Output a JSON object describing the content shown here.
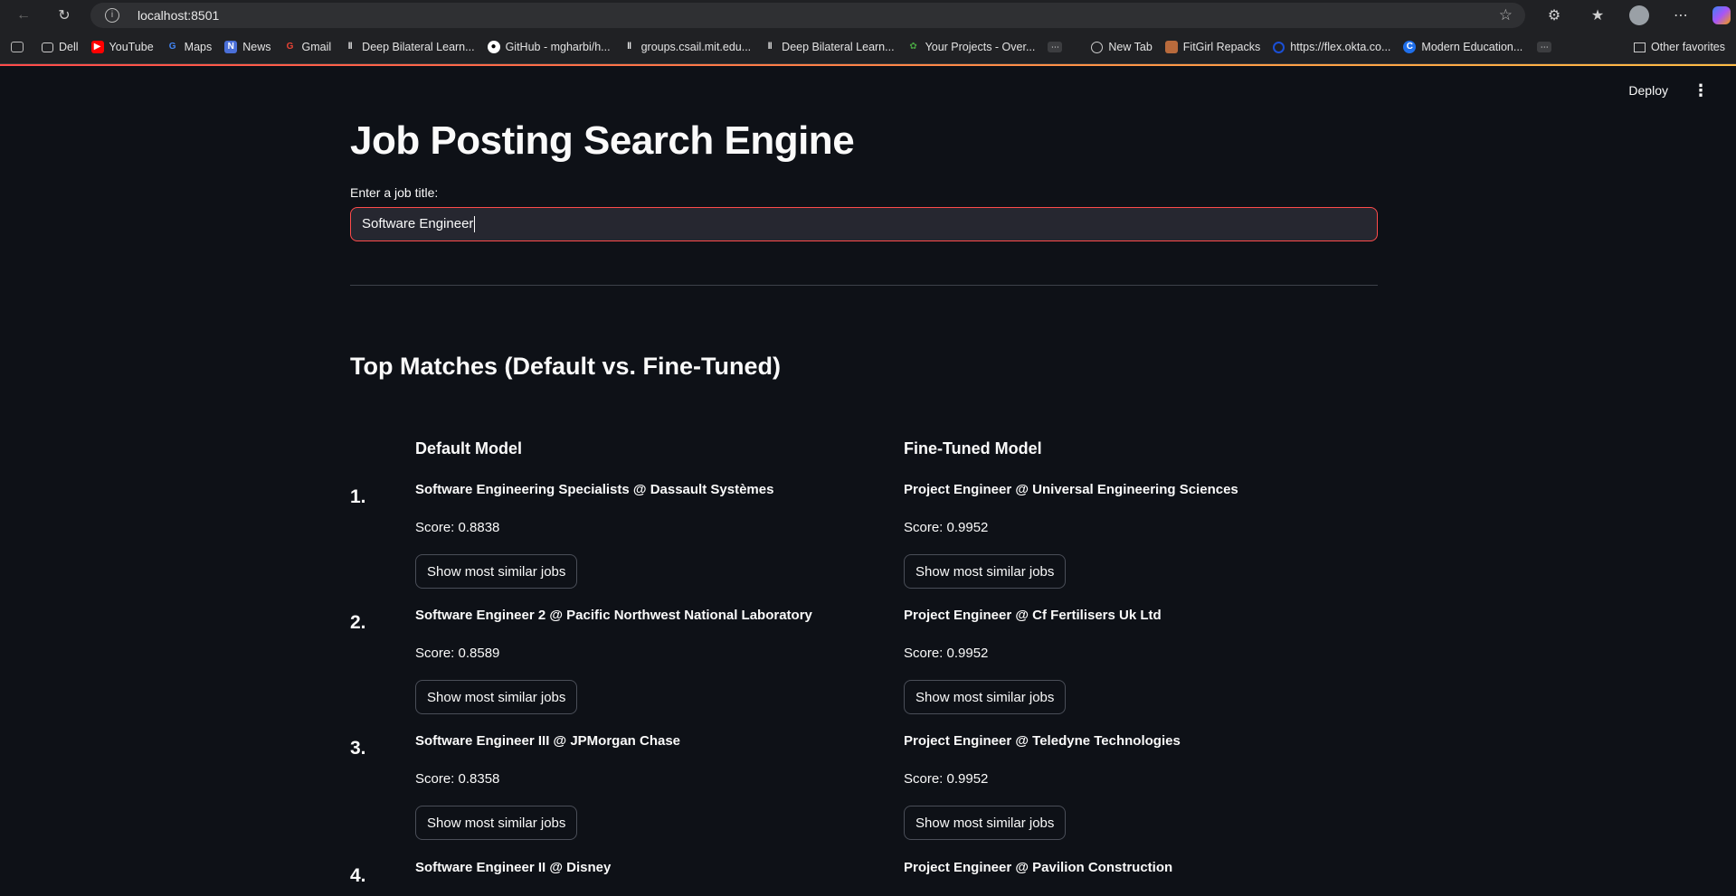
{
  "browser": {
    "url": "localhost:8501",
    "bookmarks": [
      {
        "label": "Dell",
        "icon": "folder-icon"
      },
      {
        "label": "YouTube",
        "icon": "youtube-icon"
      },
      {
        "label": "Maps",
        "icon": "google-icon"
      },
      {
        "label": "News",
        "icon": "news-icon"
      },
      {
        "label": "Gmail",
        "icon": "google-icon"
      },
      {
        "label": "Deep Bilateral Learn...",
        "icon": "paper-icon"
      },
      {
        "label": "GitHub - mgharbi/h...",
        "icon": "github-icon"
      },
      {
        "label": "groups.csail.mit.edu...",
        "icon": "paper-icon"
      },
      {
        "label": "Deep Bilateral Learn...",
        "icon": "paper-icon"
      },
      {
        "label": "Your Projects - Over...",
        "icon": "overleaf-icon"
      },
      {
        "label": "New Tab",
        "icon": "globe-icon"
      },
      {
        "label": "FitGirl Repacks",
        "icon": "site-icon"
      },
      {
        "label": "https://flex.okta.co...",
        "icon": "okta-icon"
      },
      {
        "label": "Modern Education...",
        "icon": "c-icon"
      }
    ],
    "other_favorites": "Other favorites"
  },
  "app": {
    "deploy_label": "Deploy",
    "title": "Job Posting Search Engine",
    "input_label": "Enter a job title:",
    "input_value": "Software Engineer",
    "section_title": "Top Matches (Default vs. Fine-Tuned)",
    "default_header": "Default Model",
    "finetuned_header": "Fine-Tuned Model",
    "button_label": "Show most similar jobs",
    "results": [
      {
        "num": "1.",
        "default": {
          "job": "Software Engineering Specialists @ Dassault Systèmes",
          "score": "Score: 0.8838"
        },
        "finetuned": {
          "job": "Project Engineer @ Universal Engineering Sciences",
          "score": "Score: 0.9952"
        }
      },
      {
        "num": "2.",
        "default": {
          "job": "Software Engineer 2 @ Pacific Northwest National Laboratory",
          "score": "Score: 0.8589"
        },
        "finetuned": {
          "job": "Project Engineer @ Cf Fertilisers Uk Ltd",
          "score": "Score: 0.9952"
        }
      },
      {
        "num": "3.",
        "default": {
          "job": "Software Engineer III @ JPMorgan Chase",
          "score": "Score: 0.8358"
        },
        "finetuned": {
          "job": "Project Engineer @ Teledyne Technologies",
          "score": "Score: 0.9952"
        }
      },
      {
        "num": "4.",
        "default": {
          "job": "Software Engineer II @ Disney",
          "score": ""
        },
        "finetuned": {
          "job": "Project Engineer @ Pavilion Construction",
          "score": ""
        }
      }
    ]
  }
}
